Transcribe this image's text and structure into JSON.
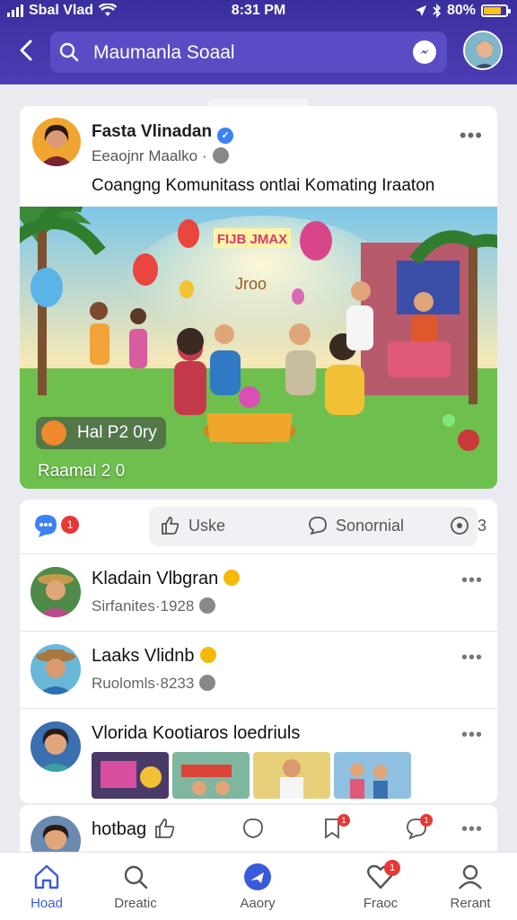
{
  "status_bar": {
    "carrier": "Sbal Vlad",
    "time": "8:31 PM",
    "battery": "80%",
    "battery_level": 0.8
  },
  "header": {
    "search_text": "Maumanla Soaal"
  },
  "post": {
    "author": "Fasta Vlinadan",
    "subtitle": "Eeaojnr Maalko ·",
    "text": "Coangng Komunitass ontlai  Komating Iraaton",
    "image_tag": "Hal P2 0ry",
    "image_caption": "Raamal 2 0",
    "image_banner": "FIJB JMAX",
    "image_scribble": "Jroo"
  },
  "actions": {
    "messages_badge": "1",
    "like_label": "Uske",
    "comment_label": "Sonornial",
    "share_count": "3"
  },
  "feed": [
    {
      "name": "Kladain Vlbgran",
      "subtitle": "Sirfanites·1928"
    },
    {
      "name": "Laaks Vlidnb",
      "subtitle": "Ruolomls·8233"
    },
    {
      "name": "Vlorida Kootiaros loedriuls",
      "subtitle": ""
    }
  ],
  "peek": {
    "name": "hotbag",
    "badge_1": "1",
    "badge_2": "1"
  },
  "tabs": [
    {
      "label": "Hoad",
      "icon": "home-icon",
      "active": true
    },
    {
      "label": "Dreatic",
      "icon": "search-icon",
      "active": false
    },
    {
      "label": "Aaory",
      "icon": "create-icon",
      "active": false
    },
    {
      "label": "Fraoc",
      "icon": "heart-icon",
      "active": false,
      "badge": "1"
    },
    {
      "label": "Rerant",
      "icon": "profile-icon",
      "active": false
    }
  ],
  "colors": {
    "header": "#3a2f9e",
    "accent": "#3a5bd9",
    "badge": "#e53935"
  }
}
